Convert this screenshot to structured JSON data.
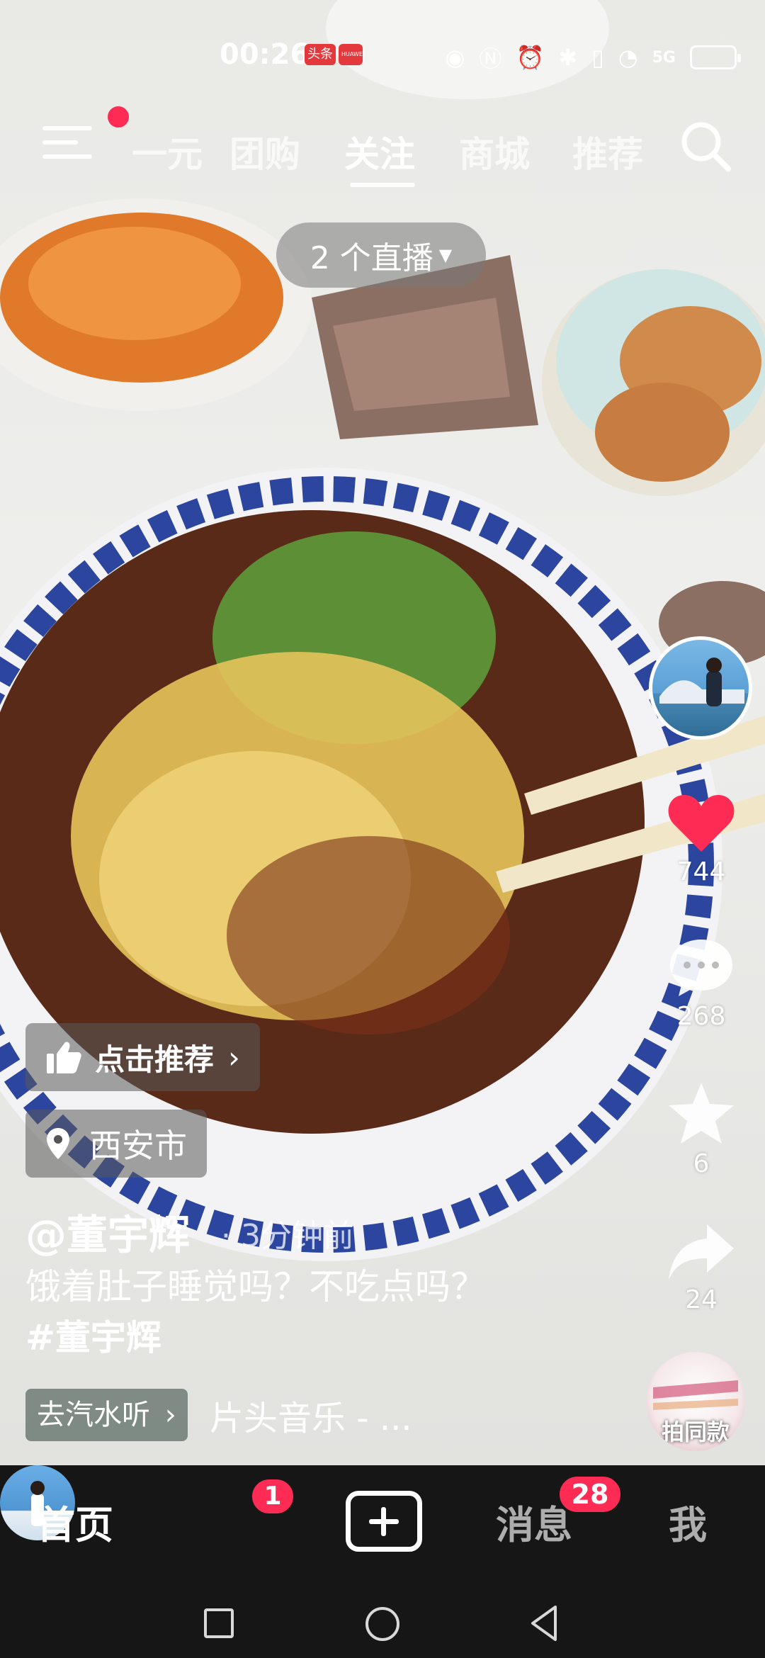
{
  "status_bar": {
    "time": "00:26",
    "badge1": "头条",
    "badge2": "HUAWEI",
    "signal_label": "5G"
  },
  "top_nav": {
    "tabs": [
      "一元",
      "团购",
      "关注",
      "商城",
      "推荐"
    ],
    "active_tab": "关注",
    "live_pill": "2 个直播"
  },
  "right_rail": {
    "likes": "744",
    "comments": "268",
    "favorites": "6",
    "shares": "24",
    "same_style_label": "拍同款"
  },
  "post": {
    "recommend_chip": "点击推荐",
    "location": "西安市",
    "author": "@董宇辉",
    "time": "· 3分钟前",
    "caption_text": "饿着肚子睡觉吗？不吃点吗？",
    "caption_tag": "#董宇辉",
    "music_chip": "去汽水听",
    "music_title": "片头音乐 - ..."
  },
  "bottom_nav": {
    "home": "首页",
    "friend_badge": "1",
    "messages": "消息",
    "messages_badge": "28",
    "me": "我"
  },
  "colors": {
    "accent": "#fe2c55",
    "nav_bg": "#161616"
  }
}
